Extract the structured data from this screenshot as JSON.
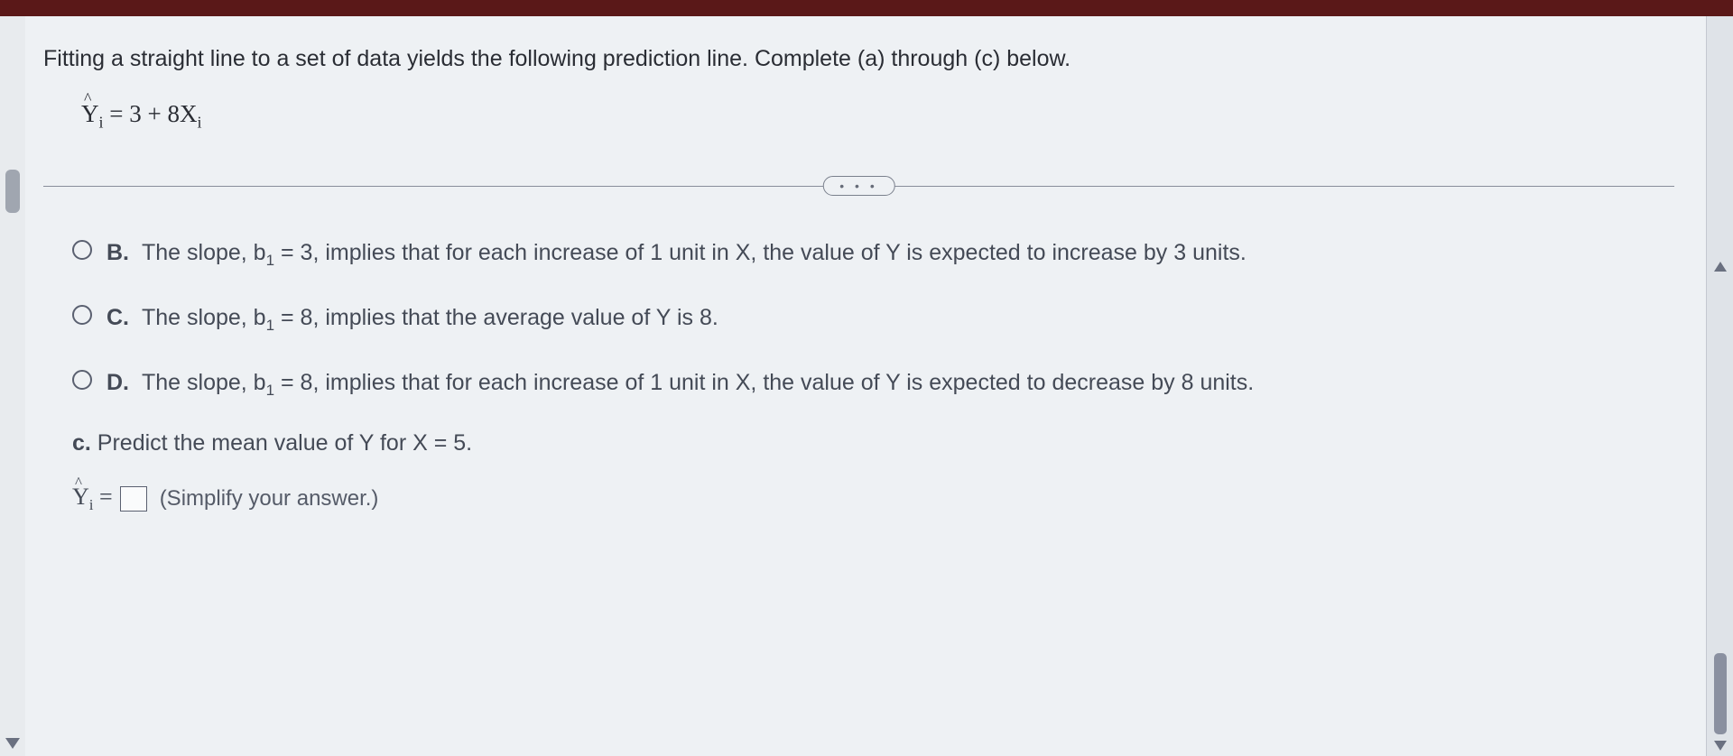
{
  "question": {
    "intro": "Fitting a straight line to a set of data yields the following prediction line. Complete (a) through (c) below.",
    "equation_y": "Y",
    "equation_sub": "i",
    "equation_rhs": " = 3 + 8X",
    "equation_rhs_sub": "i"
  },
  "divider_dots": "• • •",
  "options": {
    "b": {
      "letter": "B.",
      "text_1": "The slope, b",
      "sub_1": "1",
      "text_2": " = 3, implies that for each increase of 1 unit in X, the value of Y is expected to increase by 3 units."
    },
    "c": {
      "letter": "C.",
      "text_1": "The slope, b",
      "sub_1": "1",
      "text_2": " = 8, implies that the average value of Y is 8."
    },
    "d": {
      "letter": "D.",
      "text_1": "The slope, b",
      "sub_1": "1",
      "text_2": " = 8, implies that for each increase of 1 unit in X, the value of Y is expected to decrease by 8 units."
    }
  },
  "part_c": {
    "letter": "c.",
    "text": " Predict the mean value of Y for X = 5."
  },
  "answer": {
    "y": "Y",
    "sub": "i",
    "equals": " = ",
    "note": "(Simplify your answer.)"
  }
}
